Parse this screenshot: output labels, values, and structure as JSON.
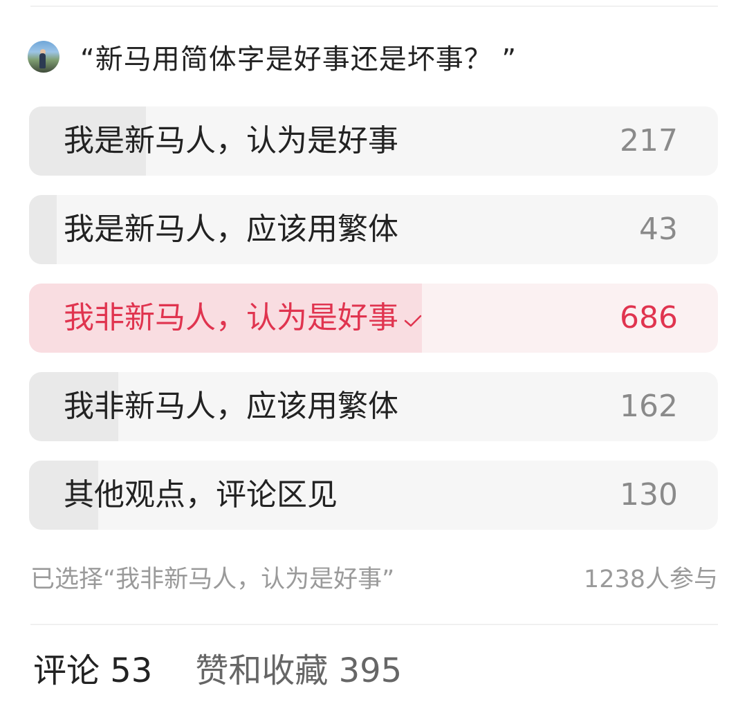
{
  "poll": {
    "question": "“新马用简体字是好事还是坏事？ ”",
    "options": [
      {
        "label": "我是新马人，认为是好事",
        "count": "217",
        "share": 0.17,
        "selected": false
      },
      {
        "label": "我是新马人，应该用繁体",
        "count": "43",
        "share": 0.04,
        "selected": false
      },
      {
        "label": "我非新马人，认为是好事",
        "count": "686",
        "share": 0.57,
        "selected": true
      },
      {
        "label": "我非新马人，应该用繁体",
        "count": "162",
        "share": 0.13,
        "selected": false
      },
      {
        "label": "其他观点，评论区见",
        "count": "130",
        "share": 0.1,
        "selected": false
      }
    ],
    "selected_text": "已选择“我非新马人，认为是好事”",
    "participants": "1238人参与"
  },
  "tabs": [
    {
      "label": "评论 53",
      "active": true
    },
    {
      "label": "赞和收藏 395",
      "active": false
    }
  ],
  "colors": {
    "accent": "#e0344f",
    "selected_fill": "#f9dde1",
    "bar_fill": "#e9e9e9",
    "bar_bg": "#f6f6f6"
  }
}
